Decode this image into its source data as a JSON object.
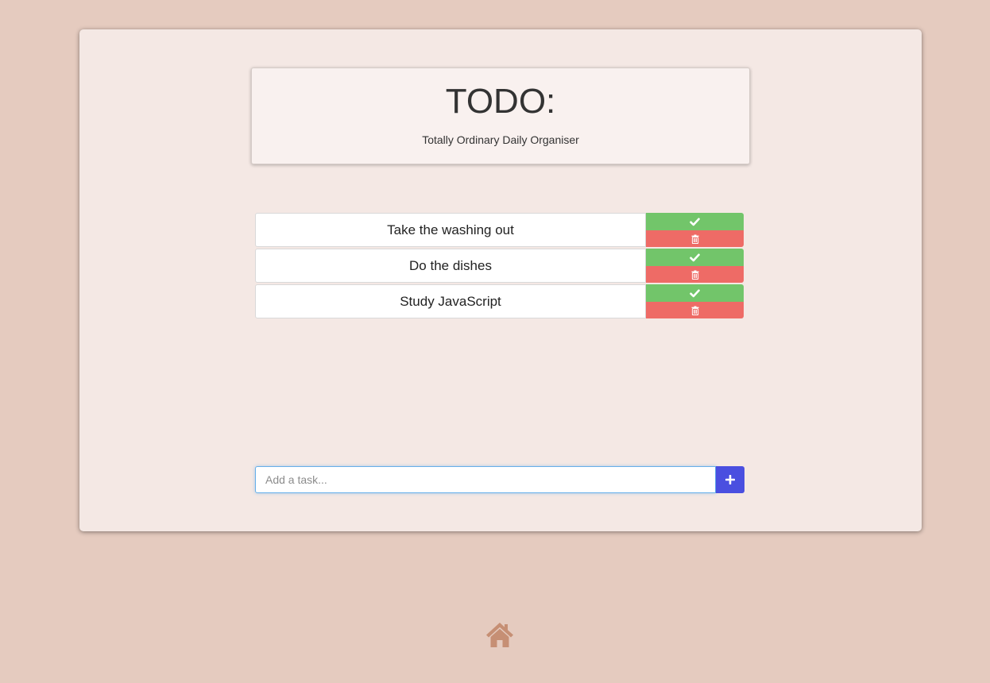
{
  "header": {
    "title": "TODO:",
    "subtitle": "Totally Ordinary Daily Organiser"
  },
  "tasks": [
    {
      "text": "Take the washing out"
    },
    {
      "text": "Do the dishes"
    },
    {
      "text": "Study JavaScript"
    }
  ],
  "actions": {
    "complete_icon": "check-icon",
    "delete_icon": "trash-icon"
  },
  "add_task": {
    "placeholder": "Add a task...",
    "value": "",
    "button_icon": "plus-icon"
  },
  "footer": {
    "home_icon": "home-icon"
  },
  "colors": {
    "page_background": "#e5cbbf",
    "card_background": "#f4e8e4",
    "complete": "#72c56a",
    "delete": "#ee6b66",
    "add_button": "#4a4fe0",
    "home_icon": "#c68f74"
  }
}
